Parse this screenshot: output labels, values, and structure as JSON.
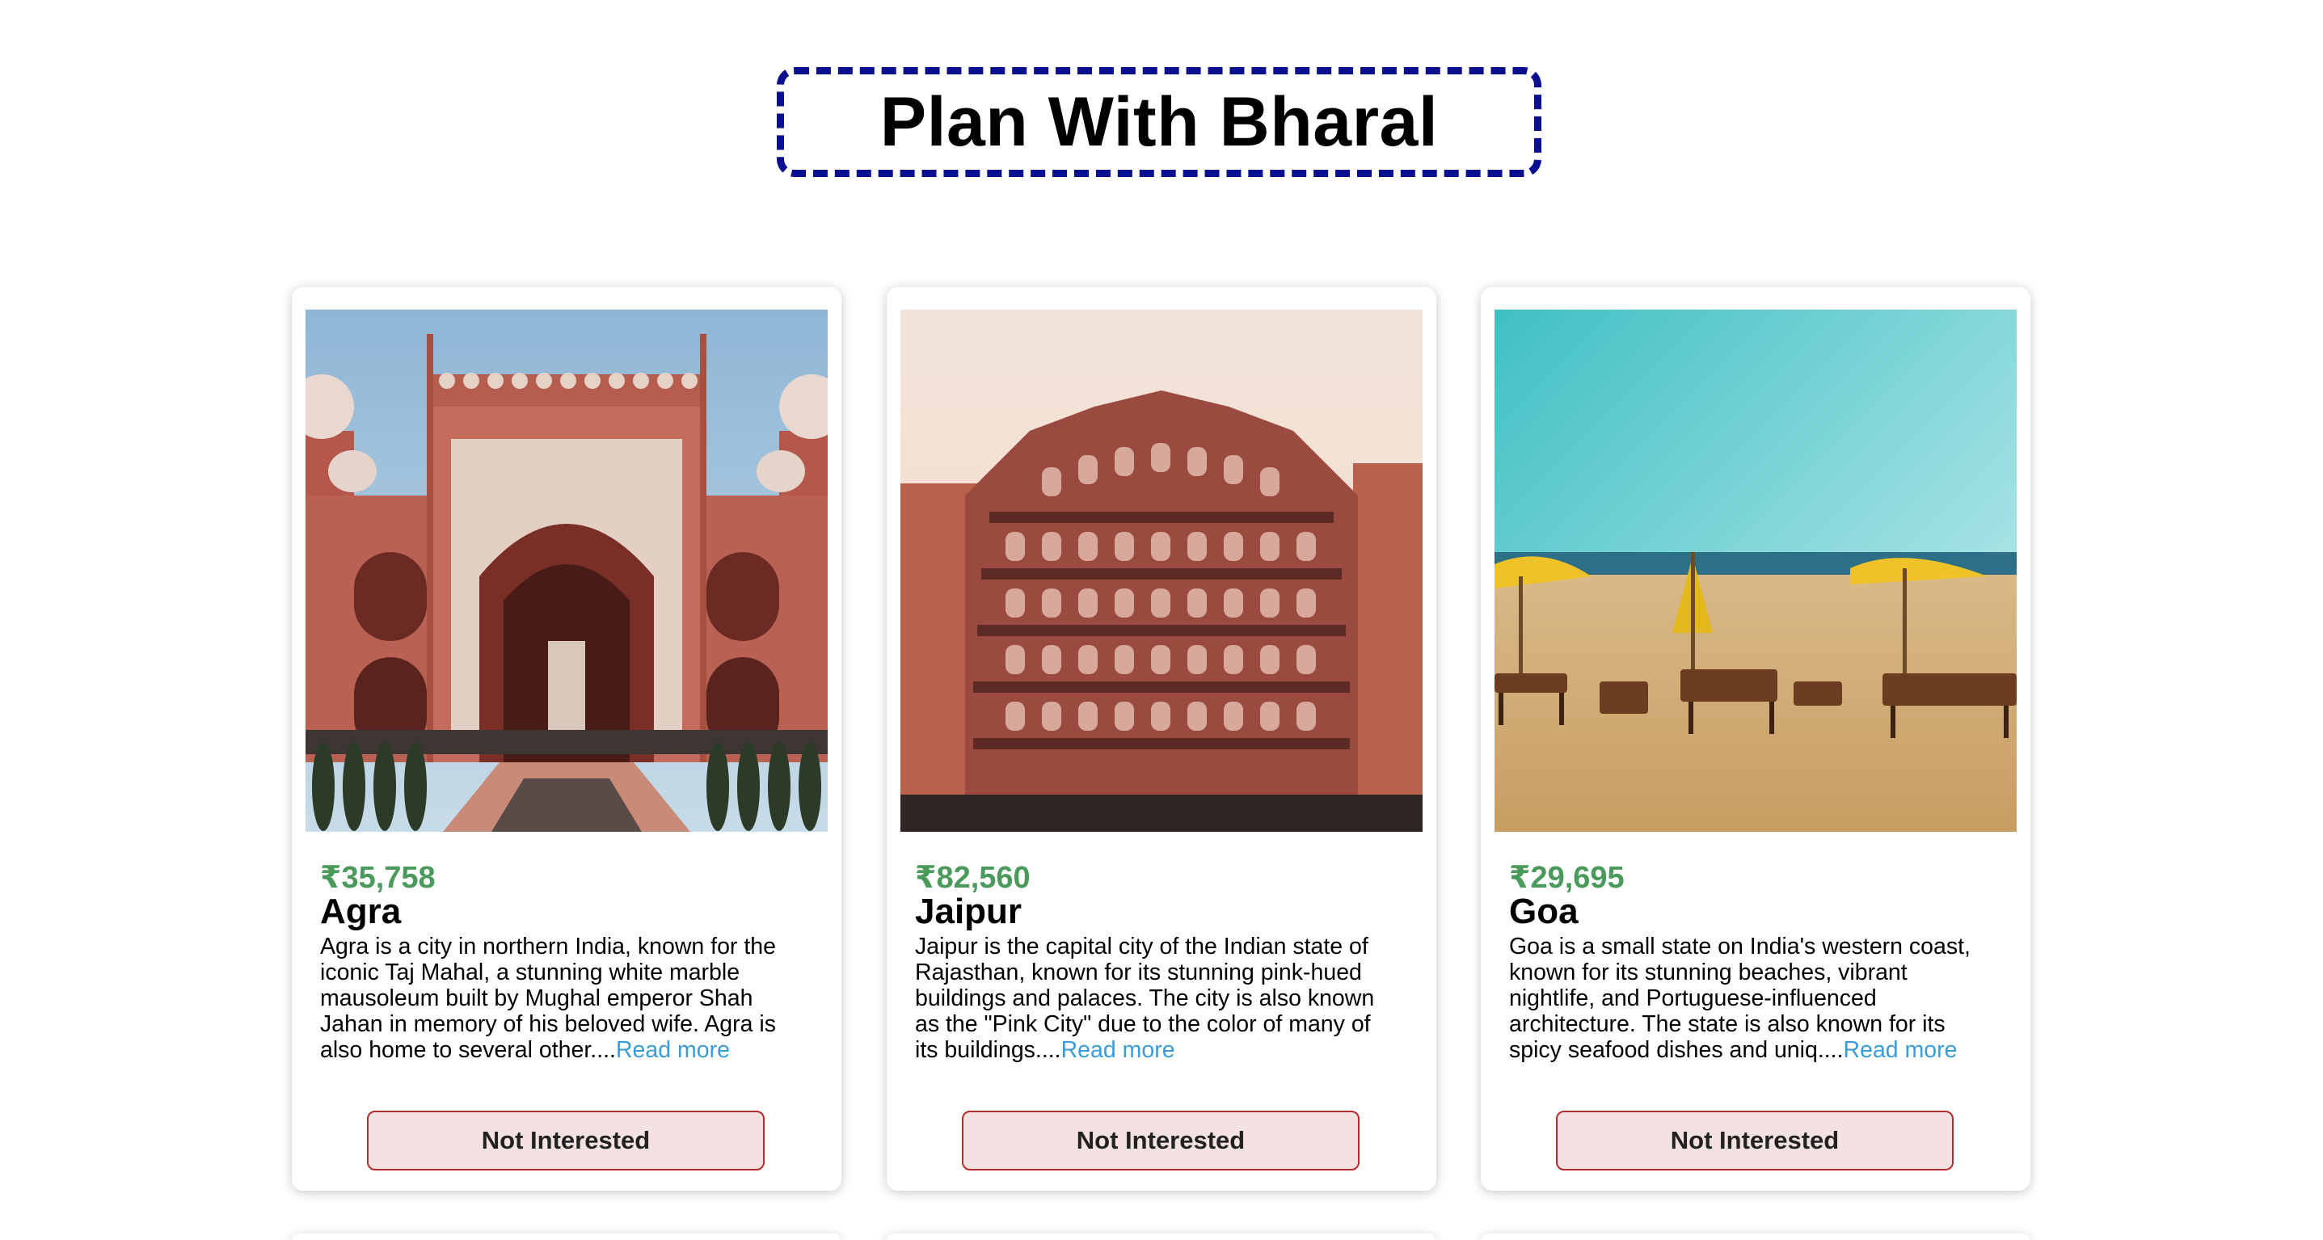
{
  "header": {
    "title": "Plan With Bharal"
  },
  "cards": [
    {
      "image_alt": "Agra gateway with red sandstone arch",
      "price": "₹35,758",
      "name": "Agra",
      "description": "Agra is a city in northern India, known for the iconic Taj Mahal, a stunning white marble mausoleum built by Mughal emperor Shah Jahan in memory of his beloved wife. Agra is also home to several other....",
      "read_more": "Read more",
      "button": "Not Interested"
    },
    {
      "image_alt": "Hawa Mahal pink facade in Jaipur",
      "price": "₹82,560",
      "name": "Jaipur",
      "description": "Jaipur is the capital city of the Indian state of Rajasthan, known for its stunning pink-hued buildings and palaces. The city is also known as the \"Pink City\" due to the color of many of its buildings....",
      "read_more": "Read more",
      "button": "Not Interested"
    },
    {
      "image_alt": "Goa beach with yellow umbrellas",
      "price": "₹29,695",
      "name": "Goa",
      "description": "Goa is a small state on India's western coast, known for its stunning beaches, vibrant nightlife, and Portuguese-influenced architecture. The state is also known for its spicy seafood dishes and uniq....",
      "read_more": "Read more",
      "button": "Not Interested"
    }
  ],
  "colors": {
    "title_border": "#0a0f8f",
    "price": "#4a9a5c",
    "read_more": "#3b9bd6",
    "button_border": "#b52a2a",
    "button_bg": "#f4e2e2"
  }
}
